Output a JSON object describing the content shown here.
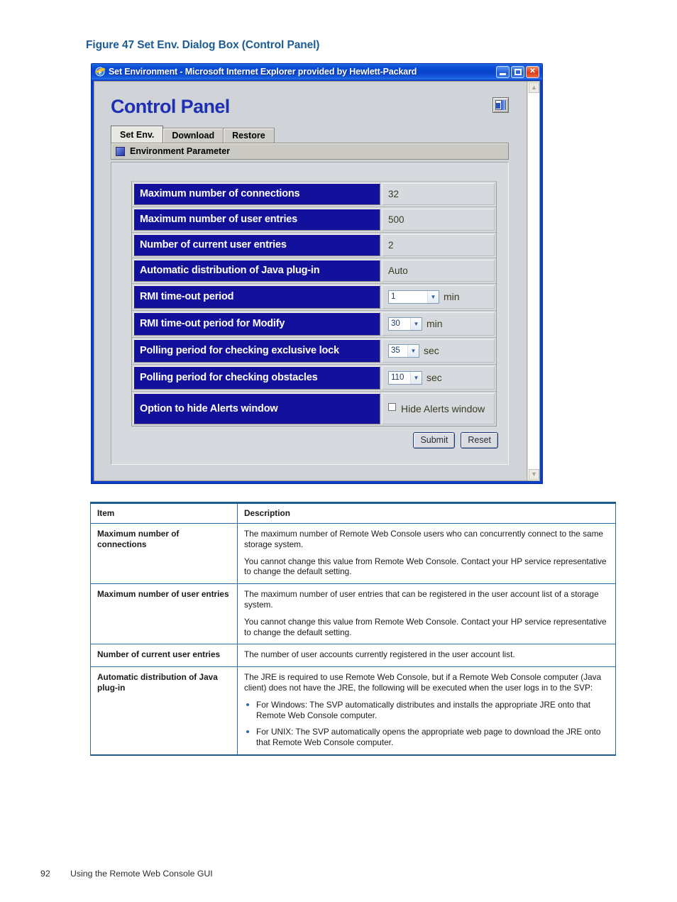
{
  "figure": {
    "caption": "Figure 47 Set Env. Dialog Box (Control Panel)",
    "caption_color": "#1b5c96"
  },
  "window": {
    "title": "Set Environment - Microsoft Internet Explorer provided by Hewlett-Packard",
    "icon": "internet-explorer-icon",
    "minimize_label": "Minimize",
    "maximize_label": "Maximize",
    "close_label": "Close",
    "titlebar_color": "#0a43cd"
  },
  "page": {
    "heading": "Control Panel",
    "heading_color": "#1f2fb4",
    "exit_button_label": "Logout",
    "tabs": [
      {
        "label": "Set Env.",
        "active": true
      },
      {
        "label": "Download",
        "active": false
      },
      {
        "label": "Restore",
        "active": false
      }
    ],
    "section_title": "Environment Parameter"
  },
  "parameters": {
    "rows": [
      {
        "name": "Maximum number of connections",
        "kind": "text",
        "value": "32"
      },
      {
        "name": "Maximum number of user entries",
        "kind": "text",
        "value": "500"
      },
      {
        "name": "Number of current user entries",
        "kind": "text",
        "value": "2"
      },
      {
        "name": "Automatic distribution of Java plug-in",
        "kind": "text",
        "value": "Auto"
      },
      {
        "name": "RMI time-out period",
        "kind": "select",
        "value": "1",
        "unit": "min"
      },
      {
        "name": "RMI time-out period for Modify",
        "kind": "select",
        "value": "30",
        "unit": "min"
      },
      {
        "name": "Polling period for checking exclusive lock",
        "kind": "select",
        "value": "35",
        "unit": "sec"
      },
      {
        "name": "Polling period for checking obstacles",
        "kind": "select",
        "value": "110",
        "unit": "sec"
      },
      {
        "name": "Option to hide Alerts window",
        "kind": "checkbox",
        "value": "Hide Alerts window",
        "checked": false
      }
    ]
  },
  "form_buttons": {
    "submit": "Submit",
    "reset": "Reset"
  },
  "description_table": {
    "headers": [
      "Item",
      "Description"
    ],
    "rows": [
      {
        "item": "Maximum number of connections",
        "paragraphs": [
          "The maximum number of Remote Web Console users who can concurrently connect to the same storage system.",
          "You cannot change this value from Remote Web Console. Contact your HP service representative to change the default setting."
        ],
        "bullets": []
      },
      {
        "item": "Maximum number of user entries",
        "paragraphs": [
          "The maximum number of user entries that can be registered in the user account list of a storage system.",
          "You cannot change this value from Remote Web Console. Contact your HP service representative to change the default setting."
        ],
        "bullets": []
      },
      {
        "item": "Number of current user entries",
        "paragraphs": [
          "The number of user accounts currently registered in the user account list."
        ],
        "bullets": []
      },
      {
        "item": "Automatic distribution of Java plug-in",
        "paragraphs": [
          "The JRE is required to use Remote Web Console, but if a Remote Web Console computer (Java client) does not have the JRE, the following will be executed when the user logs in to the SVP:"
        ],
        "bullets": [
          "For Windows: The SVP automatically distributes and installs the appropriate JRE onto that Remote Web Console computer.",
          "For UNIX: The SVP automatically opens the appropriate web page to download the JRE onto that Remote Web Console computer."
        ]
      }
    ]
  },
  "footer": {
    "page_number": "92",
    "section": "Using the Remote Web Console GUI"
  }
}
